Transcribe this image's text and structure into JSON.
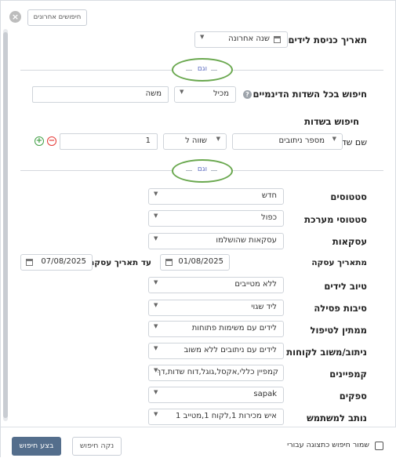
{
  "header": {
    "close_glyph": "×",
    "recent_searches": "חיפושים אחרונים"
  },
  "lead_date": {
    "label": "תאריך כניסת לידים",
    "value": "שנה אחרונה"
  },
  "and_label": "וגם",
  "dynamic": {
    "label": "חיפוש בכל השדות הדינמיים",
    "help": "?",
    "operator": "מכיל",
    "value": "משה"
  },
  "field_search": {
    "title": "חיפוש בשדות",
    "field_name_label": "שם שדה",
    "field": "מספר ניתובים",
    "operator": "שווה ל",
    "value": "1",
    "add_glyph": "+",
    "remove_glyph": "−"
  },
  "filters": {
    "statuses": {
      "label": "סטטוסים",
      "value": "חדש"
    },
    "system_statuses": {
      "label": "סטטוסי מערכת",
      "value": "כפול"
    },
    "deals": {
      "label": "עסקאות",
      "value": "עסקאות שהושלמו"
    },
    "deal_date_from": {
      "label": "מתאריך עסקה",
      "value": "01/08/2025"
    },
    "deal_date_to": {
      "label": "עד תאריך עסקה",
      "value": "07/08/2025"
    },
    "lead_quality": {
      "label": "טיוב לידים",
      "value": "ללא מטייבים"
    },
    "disqualify": {
      "label": "סיבות פסילה",
      "value": "ליד שגוי"
    },
    "awaiting": {
      "label": "ממתין לטיפול",
      "value": "לידים עם משימות פתוחות"
    },
    "routing": {
      "label": "ניתוב/משוב לקוחות",
      "value": "לידים עם ניתובים ללא משוב"
    },
    "campaigns": {
      "label": "קמפיינים",
      "value": "קמפיין כללי,אקסל,גוגל,דוח שדות,דף"
    },
    "suppliers": {
      "label": "ספקים",
      "value": "sapak"
    },
    "routed_user": {
      "label": "נותב למשתמש",
      "value": "איש מכירות 1,לקוח 1,מטייב 1"
    }
  },
  "footer": {
    "save_as_report": "שמור חיפוש כתצוגה עבורי",
    "clear": "נקה חיפוש",
    "run": "בצע חיפוש"
  },
  "colors": {
    "accent": "#546e8c",
    "and_circle": "#6aa84f",
    "and_text": "#5c6bc0",
    "add": "#43a047",
    "remove": "#e53935"
  }
}
